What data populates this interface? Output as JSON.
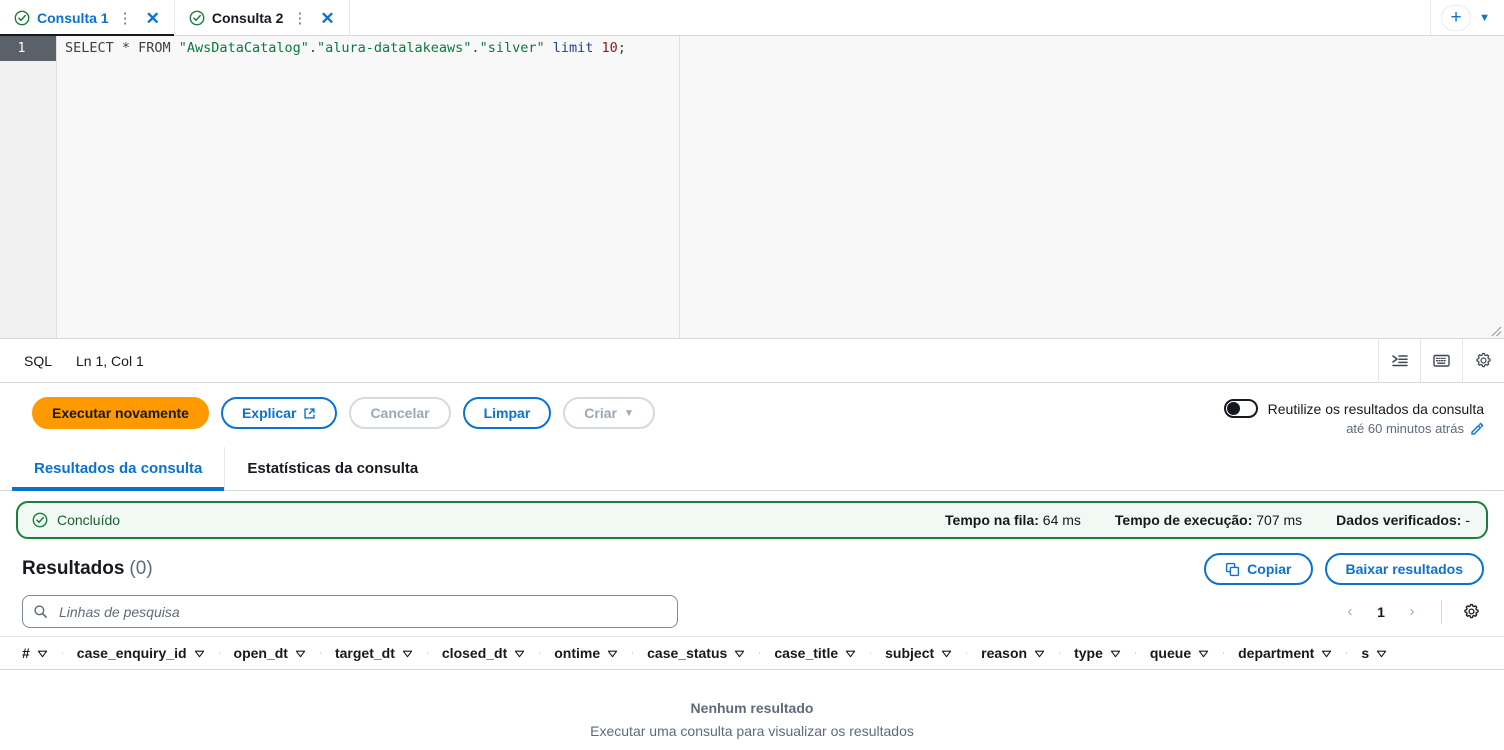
{
  "tabs": [
    {
      "label": "Consulta 1",
      "active": true,
      "status_icon": "check-circle-icon",
      "kebab": "⋮",
      "close": "✕"
    },
    {
      "label": "Consulta 2",
      "active": false,
      "status_icon": "check-circle-icon",
      "kebab": "⋮",
      "close": "✕"
    }
  ],
  "tabstrip_actions": {
    "add_label": "+",
    "caret": "▼"
  },
  "editor": {
    "line_number": "1",
    "sql_tokens": {
      "select": "SELECT * FROM ",
      "catalog": "\"AwsDataCatalog\"",
      "dot1": ".",
      "database": "\"alura-datalakeaws\"",
      "dot2": ".",
      "table": "\"silver\"",
      "space": " ",
      "limit_kw": "limit",
      "space2": " ",
      "limit_num": "10",
      "semicolon": ";"
    },
    "full_sql": "SELECT * FROM \"AwsDataCatalog\".\"alura-datalakeaws\".\"silver\" limit 10;"
  },
  "statusbar": {
    "language": "SQL",
    "cursor": "Ln 1, Col 1",
    "icons": [
      "format-indent-icon",
      "keyboard-icon",
      "gear-icon"
    ]
  },
  "actions": {
    "run_again": "Executar novamente",
    "explain": "Explicar",
    "explain_icon": "external-link-icon",
    "cancel": "Cancelar",
    "clear": "Limpar",
    "create": "Criar",
    "create_caret": "▼"
  },
  "reuse": {
    "label": "Reutilize os resultados da consulta",
    "sub": "até 60 minutos atrás",
    "edit_icon": "pencil-icon",
    "enabled": false
  },
  "result_tabs": [
    {
      "label": "Resultados da consulta",
      "active": true
    },
    {
      "label": "Estatísticas da consulta",
      "active": false
    }
  ],
  "alert": {
    "status": "Concluído",
    "status_icon": "check-circle-icon",
    "metrics": [
      {
        "label": "Tempo na fila:",
        "value": "64 ms"
      },
      {
        "label": "Tempo de execução:",
        "value": "707 ms"
      },
      {
        "label": "Dados verificados:",
        "value": "-"
      }
    ]
  },
  "results": {
    "title": "Resultados",
    "count": "(0)",
    "copy_button": "Copiar",
    "copy_icon": "copy-icon",
    "download_button": "Baixar resultados"
  },
  "search": {
    "placeholder": "Linhas de pesquisa",
    "value": "",
    "icon": "search-icon"
  },
  "pagination": {
    "prev": "‹",
    "page": "1",
    "next": "›",
    "settings_icon": "gear-icon"
  },
  "table": {
    "columns": [
      "#",
      "case_enquiry_id",
      "open_dt",
      "target_dt",
      "closed_dt",
      "ontime",
      "case_status",
      "case_title",
      "subject",
      "reason",
      "type",
      "queue",
      "department",
      "s"
    ],
    "empty_title": "Nenhum resultado",
    "empty_sub": "Executar uma consulta para visualizar os resultados"
  },
  "colors": {
    "accent_blue": "#0972d3",
    "primary_orange": "#ff9900",
    "success_green": "#1b7d3e",
    "text_dark": "#16191f",
    "text_muted": "#5f6b7a"
  }
}
